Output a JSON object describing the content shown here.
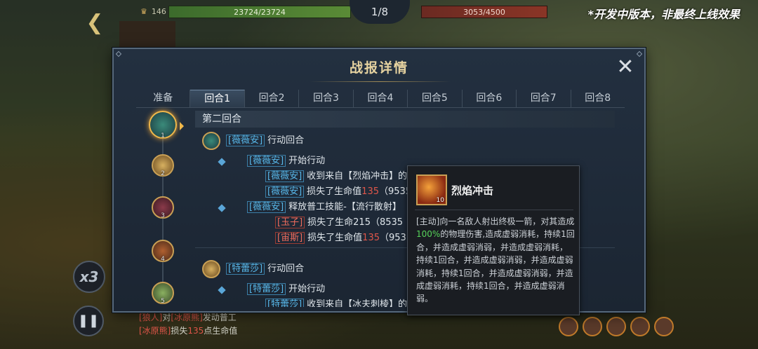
{
  "topbar": {
    "back_icon": "back-arrow-icon",
    "coin_count": "146",
    "ally_hp": "23724/23724",
    "round_counter": "1/8",
    "enemy_hp": "3053/4500",
    "dev_notice": "*开发中版本，非最终上线效果"
  },
  "controls": {
    "speed_label": "x3",
    "pause_icon": "pause-icon"
  },
  "bottom_log": [
    {
      "p1": "[狼人]",
      "p2": "对",
      "p3": "[冰原熊]",
      "p4": "发动普工"
    },
    {
      "p1": "[冰原熊]",
      "p2": "损失",
      "p3": "135",
      "p4": "点生命值"
    }
  ],
  "dialog": {
    "title": "战报详情",
    "tabs": [
      "准备",
      "回合1",
      "回合2",
      "回合3",
      "回合4",
      "回合5",
      "回合6",
      "回合7",
      "回合8"
    ],
    "active_tab": 1,
    "portrait_numbers": [
      "1",
      "2",
      "3",
      "4",
      "5"
    ],
    "round_header": "第二回合",
    "log": {
      "actor1_name": "[薇薇安]",
      "actor1_action": "行动回合",
      "l1_name": "[薇薇安]",
      "l1_text": "开始行动",
      "l2_name": "[薇薇安]",
      "l2_text": "收到来自【烈焰冲击】的",
      "l3_name": "[薇薇安]",
      "l3_text": "损失了生命值",
      "l3_val": "135",
      "l3_rest": "（9535",
      "l4_name": "[薇薇安]",
      "l4_text": "释放普工技能-【流行散射】",
      "l5_name": "[玉子]",
      "l5_text": "损失了生命215（8535",
      "l6_name": "[宙斯]",
      "l6_text": "损失了生命值",
      "l6_val": "135",
      "l6_rest": "（953",
      "actor2_name": "[特蕾莎]",
      "actor2_action": "行动回合",
      "l7_name": "[特蕾莎]",
      "l7_text": "开始行动",
      "l8_name": "[特蕾莎]",
      "l8_text": "收到来自【冰夫刺棱】的"
    }
  },
  "tooltip": {
    "skill_name": "烈焰冲击",
    "cooldown": "10",
    "desc_part1": "[主动]向一名敌人射出终极一箭，对其造成",
    "desc_pct": "100%",
    "desc_part2": "的物理伤害,造成虚弱消耗，持续1回合，并造成虚弱消弱，并造成虚弱消耗，持续1回合，并造成虚弱消弱，并造成虚弱消耗，持续1回合，并造成虚弱消弱，并造成虚弱消耗，持续1回合，并造成虚弱消弱。"
  }
}
